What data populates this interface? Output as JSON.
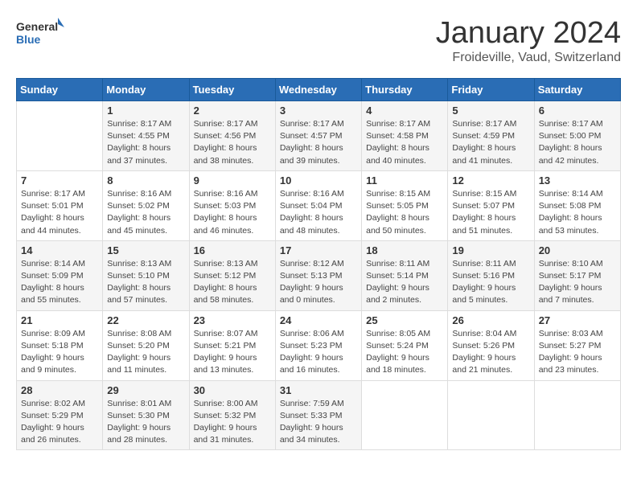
{
  "header": {
    "logo_general": "General",
    "logo_blue": "Blue",
    "title": "January 2024",
    "subtitle": "Froideville, Vaud, Switzerland"
  },
  "days_of_week": [
    "Sunday",
    "Monday",
    "Tuesday",
    "Wednesday",
    "Thursday",
    "Friday",
    "Saturday"
  ],
  "weeks": [
    [
      {
        "day": "",
        "detail": ""
      },
      {
        "day": "1",
        "detail": "Sunrise: 8:17 AM\nSunset: 4:55 PM\nDaylight: 8 hours\nand 37 minutes."
      },
      {
        "day": "2",
        "detail": "Sunrise: 8:17 AM\nSunset: 4:56 PM\nDaylight: 8 hours\nand 38 minutes."
      },
      {
        "day": "3",
        "detail": "Sunrise: 8:17 AM\nSunset: 4:57 PM\nDaylight: 8 hours\nand 39 minutes."
      },
      {
        "day": "4",
        "detail": "Sunrise: 8:17 AM\nSunset: 4:58 PM\nDaylight: 8 hours\nand 40 minutes."
      },
      {
        "day": "5",
        "detail": "Sunrise: 8:17 AM\nSunset: 4:59 PM\nDaylight: 8 hours\nand 41 minutes."
      },
      {
        "day": "6",
        "detail": "Sunrise: 8:17 AM\nSunset: 5:00 PM\nDaylight: 8 hours\nand 42 minutes."
      }
    ],
    [
      {
        "day": "7",
        "detail": "Sunrise: 8:17 AM\nSunset: 5:01 PM\nDaylight: 8 hours\nand 44 minutes."
      },
      {
        "day": "8",
        "detail": "Sunrise: 8:16 AM\nSunset: 5:02 PM\nDaylight: 8 hours\nand 45 minutes."
      },
      {
        "day": "9",
        "detail": "Sunrise: 8:16 AM\nSunset: 5:03 PM\nDaylight: 8 hours\nand 46 minutes."
      },
      {
        "day": "10",
        "detail": "Sunrise: 8:16 AM\nSunset: 5:04 PM\nDaylight: 8 hours\nand 48 minutes."
      },
      {
        "day": "11",
        "detail": "Sunrise: 8:15 AM\nSunset: 5:05 PM\nDaylight: 8 hours\nand 50 minutes."
      },
      {
        "day": "12",
        "detail": "Sunrise: 8:15 AM\nSunset: 5:07 PM\nDaylight: 8 hours\nand 51 minutes."
      },
      {
        "day": "13",
        "detail": "Sunrise: 8:14 AM\nSunset: 5:08 PM\nDaylight: 8 hours\nand 53 minutes."
      }
    ],
    [
      {
        "day": "14",
        "detail": "Sunrise: 8:14 AM\nSunset: 5:09 PM\nDaylight: 8 hours\nand 55 minutes."
      },
      {
        "day": "15",
        "detail": "Sunrise: 8:13 AM\nSunset: 5:10 PM\nDaylight: 8 hours\nand 57 minutes."
      },
      {
        "day": "16",
        "detail": "Sunrise: 8:13 AM\nSunset: 5:12 PM\nDaylight: 8 hours\nand 58 minutes."
      },
      {
        "day": "17",
        "detail": "Sunrise: 8:12 AM\nSunset: 5:13 PM\nDaylight: 9 hours\nand 0 minutes."
      },
      {
        "day": "18",
        "detail": "Sunrise: 8:11 AM\nSunset: 5:14 PM\nDaylight: 9 hours\nand 2 minutes."
      },
      {
        "day": "19",
        "detail": "Sunrise: 8:11 AM\nSunset: 5:16 PM\nDaylight: 9 hours\nand 5 minutes."
      },
      {
        "day": "20",
        "detail": "Sunrise: 8:10 AM\nSunset: 5:17 PM\nDaylight: 9 hours\nand 7 minutes."
      }
    ],
    [
      {
        "day": "21",
        "detail": "Sunrise: 8:09 AM\nSunset: 5:18 PM\nDaylight: 9 hours\nand 9 minutes."
      },
      {
        "day": "22",
        "detail": "Sunrise: 8:08 AM\nSunset: 5:20 PM\nDaylight: 9 hours\nand 11 minutes."
      },
      {
        "day": "23",
        "detail": "Sunrise: 8:07 AM\nSunset: 5:21 PM\nDaylight: 9 hours\nand 13 minutes."
      },
      {
        "day": "24",
        "detail": "Sunrise: 8:06 AM\nSunset: 5:23 PM\nDaylight: 9 hours\nand 16 minutes."
      },
      {
        "day": "25",
        "detail": "Sunrise: 8:05 AM\nSunset: 5:24 PM\nDaylight: 9 hours\nand 18 minutes."
      },
      {
        "day": "26",
        "detail": "Sunrise: 8:04 AM\nSunset: 5:26 PM\nDaylight: 9 hours\nand 21 minutes."
      },
      {
        "day": "27",
        "detail": "Sunrise: 8:03 AM\nSunset: 5:27 PM\nDaylight: 9 hours\nand 23 minutes."
      }
    ],
    [
      {
        "day": "28",
        "detail": "Sunrise: 8:02 AM\nSunset: 5:29 PM\nDaylight: 9 hours\nand 26 minutes."
      },
      {
        "day": "29",
        "detail": "Sunrise: 8:01 AM\nSunset: 5:30 PM\nDaylight: 9 hours\nand 28 minutes."
      },
      {
        "day": "30",
        "detail": "Sunrise: 8:00 AM\nSunset: 5:32 PM\nDaylight: 9 hours\nand 31 minutes."
      },
      {
        "day": "31",
        "detail": "Sunrise: 7:59 AM\nSunset: 5:33 PM\nDaylight: 9 hours\nand 34 minutes."
      },
      {
        "day": "",
        "detail": ""
      },
      {
        "day": "",
        "detail": ""
      },
      {
        "day": "",
        "detail": ""
      }
    ]
  ]
}
